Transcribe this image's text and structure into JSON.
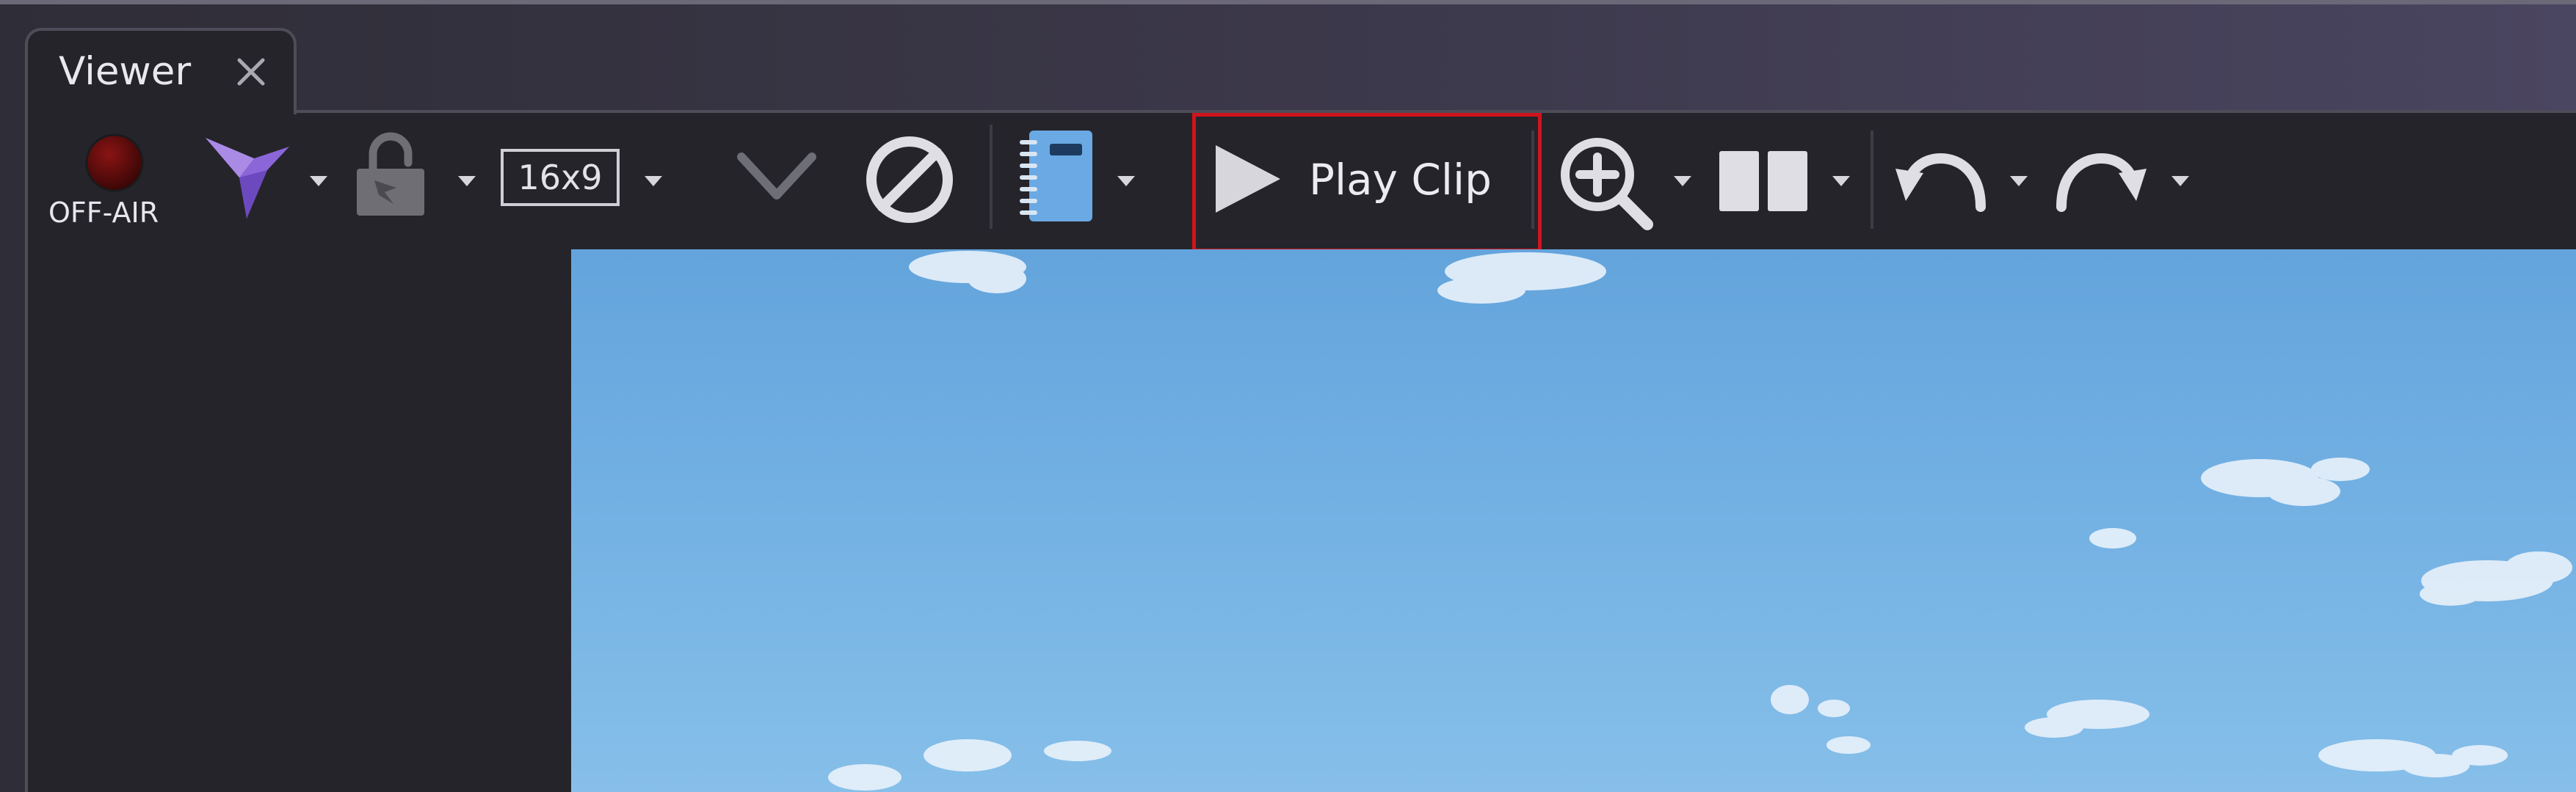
{
  "window": {
    "tab_title": "Viewer"
  },
  "toolbar": {
    "off_air_label": "OFF-AIR",
    "aspect_label": "16x9",
    "play_clip_label": "Play Clip"
  },
  "icons": {
    "air_indicator": "red-led-icon",
    "bird": "bird-logo-icon",
    "lock": "unlock-icon",
    "aspect": "aspect-ratio-box",
    "chevron": "chevron-down-icon",
    "block": "prohibited-icon",
    "notebook": "notebook-icon",
    "play": "play-icon",
    "zoom": "zoom-in-icon",
    "layout": "split-view-icon",
    "undo": "undo-icon",
    "redo": "redo-icon"
  },
  "colors": {
    "highlight": "#d0141d",
    "bird_purple": "#8b66d8",
    "notebook_blue": "#6aa9e3",
    "sky": "#72b0e3"
  }
}
